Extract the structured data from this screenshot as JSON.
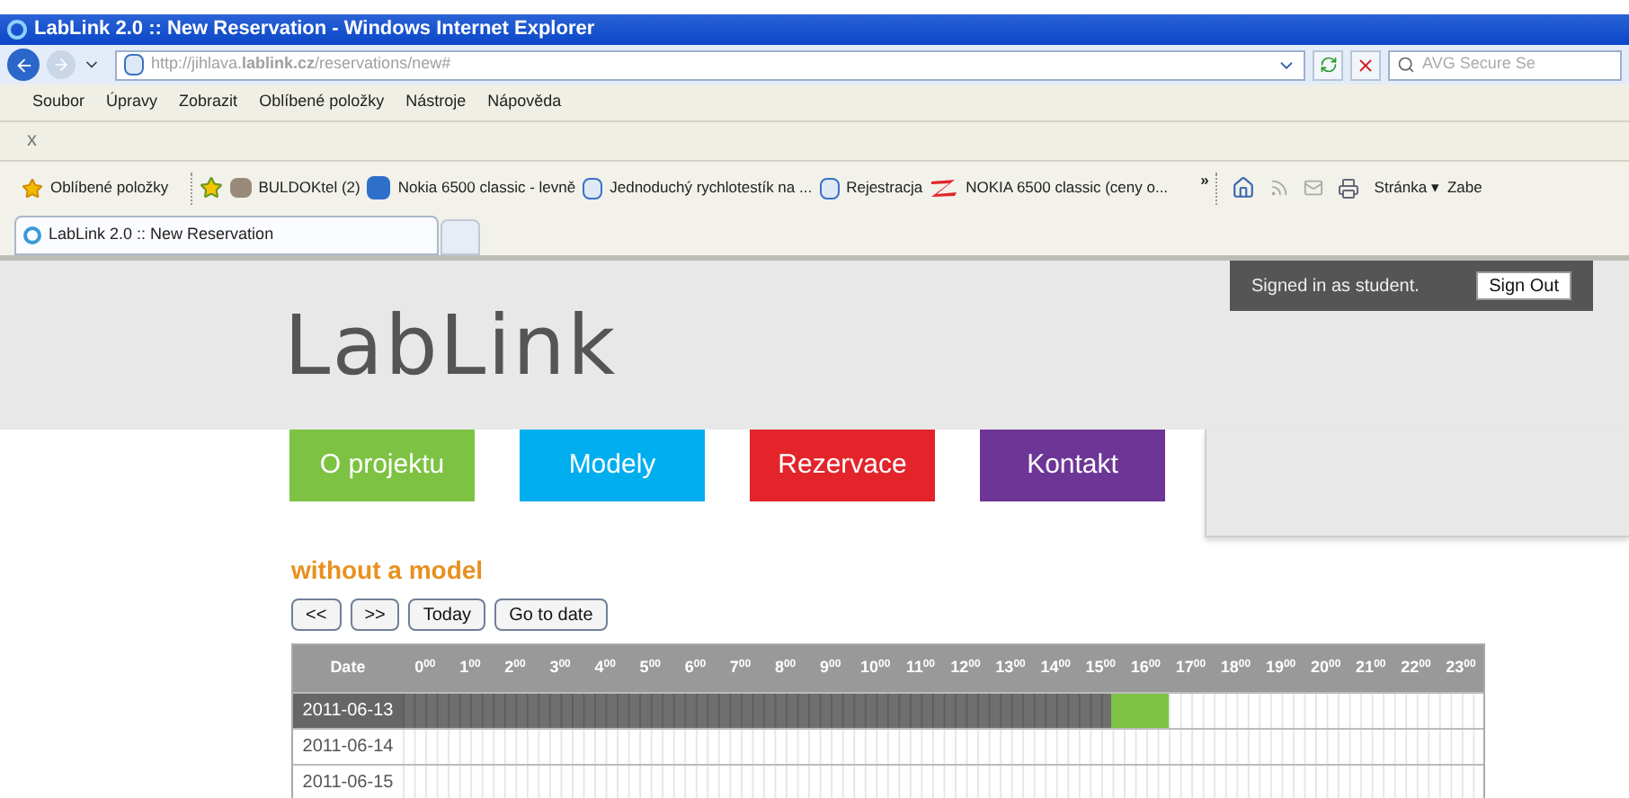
{
  "window": {
    "title": "LabLink 2.0 :: New Reservation - Windows Internet Explorer"
  },
  "address_bar": {
    "url": "http://jihlava.**lablink.cz**/reservations/new#"
  },
  "search": {
    "placeholder": "AVG Secure Se"
  },
  "menu": [
    "Soubor",
    "Úpravy",
    "Zobrazit",
    "Oblíbené položky",
    "Nástroje",
    "Nápověda"
  ],
  "toolbar_close": "x",
  "favorites_bar": {
    "label": "Oblíbené položky",
    "links": [
      {
        "title": "BULDOKtel (2)",
        "kind": "image"
      },
      {
        "title": "Nokia 6500 classic - levně",
        "kind": "app"
      },
      {
        "title": "Jednoduchý rychlotestík na ...",
        "kind": "page"
      },
      {
        "title": "Rejestracja",
        "kind": "page"
      },
      {
        "title": "NOKIA 6500 classic (ceny o...",
        "kind": "logo"
      }
    ],
    "overflow": "»",
    "page_menu": "Stránka ▾",
    "safety_menu": "Zabe"
  },
  "tabs": [
    {
      "label": "LabLink 2.0 :: New Reservation",
      "selected": true
    }
  ],
  "page": {
    "logo": "LabLink",
    "signed_in": "Signed in as student.",
    "sign_out": "Sign Out",
    "nav": [
      {
        "label": "O projektu",
        "color": "#7dc242"
      },
      {
        "label": "Modely",
        "color": "#00aeef"
      },
      {
        "label": "Rezervace",
        "color": "#e3242b"
      },
      {
        "label": "Kontakt",
        "color": "#6d3596"
      }
    ],
    "heading": "without a model",
    "buttons": [
      "<<",
      ">>",
      "Today",
      "Go to date"
    ],
    "table": {
      "columns": [
        "Date",
        "0$^{00}$",
        "1$^{00}$",
        "2$^{00}$",
        "3$^{00}$",
        "4$^{00}$",
        "5$^{00}$",
        "6$^{00}$",
        "7$^{00}$",
        "8$^{00}$",
        "9$^{00}$",
        "10$^{00}$",
        "11$^{00}$",
        "12$^{00}$",
        "13$^{00}$",
        "14$^{00}$",
        "15$^{00}$",
        "16$^{00}$",
        "17$^{00}$",
        "18$^{00}$",
        "19$^{00}$",
        "20$^{00}$",
        "21$^{00}$",
        "22$^{00}$",
        "23$^{00}$"
      ],
      "rows": [
        {
          "date": "2011-06-13",
          "selected": true,
          "segments": [
            {
              "kind": "past",
              "level": 0.656
            },
            {
              "kind": "reservation"
            }
          ]
        },
        {
          "date": "2011-06-14",
          "selected": false,
          "segments": []
        },
        {
          "date": "2011-06-15",
          "selected": false,
          "segments": []
        }
      ]
    }
  }
}
